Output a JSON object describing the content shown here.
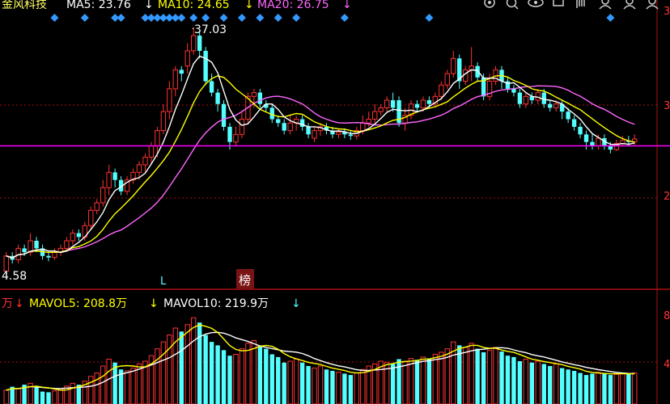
{
  "header": {
    "stock_name": "金风科技",
    "ma5": {
      "label": "MA5: 23.76",
      "arrow": "↓",
      "color": "#ffffff"
    },
    "ma10": {
      "label": "MA10: 24.65",
      "arrow": "↓",
      "color": "#ffff00"
    },
    "ma20": {
      "label": "MA20: 26.75",
      "arrow": "↓",
      "color": "#ff66ff"
    }
  },
  "volume_header": {
    "prefix": "万",
    "prefix_arrow": "↓",
    "mavol5": {
      "label": "MAVOL5: 208.8万",
      "arrow": "↓",
      "color": "#ffff00"
    },
    "mavol10": {
      "label": "MAVOL10: 219.9万",
      "arrow": "↓",
      "color": "#ffffff"
    }
  },
  "toolbar_icons": [
    "settings-icon",
    "search-icon",
    "eye-icon",
    "stamp-icon",
    "hand-icon",
    "user-icon",
    "user-icon"
  ],
  "annotations": {
    "high": "37.03",
    "low": "4.58",
    "badge": "榜",
    "marker": "L"
  },
  "right_axis_ticks": [
    "3",
    "3",
    "2",
    "8",
    "4"
  ],
  "colors": {
    "up": "#ff3333",
    "down": "#54ffff",
    "ma5": "#ffffff",
    "ma10": "#ffff00",
    "ma20": "#ff66ff",
    "hline": "#ff00ff",
    "divider": "#aa1111",
    "diamond": "#3399ff"
  },
  "chart_data": {
    "type": "candlestick",
    "price_range": [
      4.58,
      37.03
    ],
    "candles": [
      {
        "o": 5,
        "c": 7,
        "h": 7.5,
        "l": 4.58
      },
      {
        "o": 7,
        "c": 6.5,
        "h": 7.5,
        "l": 6
      },
      {
        "o": 6.5,
        "c": 8,
        "h": 8.5,
        "l": 6
      },
      {
        "o": 8,
        "c": 7.5,
        "h": 8.5,
        "l": 7
      },
      {
        "o": 7.5,
        "c": 9,
        "h": 10,
        "l": 7
      },
      {
        "o": 9,
        "c": 8,
        "h": 9.5,
        "l": 7.5
      },
      {
        "o": 8,
        "c": 7,
        "h": 8.5,
        "l": 6.5
      },
      {
        "o": 7,
        "c": 6.8,
        "h": 7.5,
        "l": 6.3
      },
      {
        "o": 6.8,
        "c": 7.5,
        "h": 8,
        "l": 6.5
      },
      {
        "o": 7.5,
        "c": 8,
        "h": 8.5,
        "l": 7
      },
      {
        "o": 8,
        "c": 9,
        "h": 9.5,
        "l": 7.5
      },
      {
        "o": 9,
        "c": 10,
        "h": 10.5,
        "l": 8.5
      },
      {
        "o": 10,
        "c": 9.5,
        "h": 10.5,
        "l": 9
      },
      {
        "o": 9.5,
        "c": 11,
        "h": 11.5,
        "l": 9
      },
      {
        "o": 11,
        "c": 13,
        "h": 13.5,
        "l": 10.5
      },
      {
        "o": 13,
        "c": 14,
        "h": 14.5,
        "l": 12.5
      },
      {
        "o": 14,
        "c": 16,
        "h": 17,
        "l": 13.5
      },
      {
        "o": 16,
        "c": 18,
        "h": 19,
        "l": 15
      },
      {
        "o": 18,
        "c": 17,
        "h": 18.5,
        "l": 16
      },
      {
        "o": 17,
        "c": 15.5,
        "h": 17.5,
        "l": 15
      },
      {
        "o": 15.5,
        "c": 17,
        "h": 17.5,
        "l": 15
      },
      {
        "o": 17,
        "c": 18,
        "h": 18.5,
        "l": 16.5
      },
      {
        "o": 18,
        "c": 19,
        "h": 19.5,
        "l": 17
      },
      {
        "o": 19,
        "c": 20,
        "h": 20.5,
        "l": 18
      },
      {
        "o": 20,
        "c": 21.5,
        "h": 22,
        "l": 19
      },
      {
        "o": 21.5,
        "c": 23.5,
        "h": 24,
        "l": 20
      },
      {
        "o": 23.5,
        "c": 26,
        "h": 27,
        "l": 23
      },
      {
        "o": 26,
        "c": 29,
        "h": 30,
        "l": 25
      },
      {
        "o": 29,
        "c": 31.5,
        "h": 32,
        "l": 28
      },
      {
        "o": 31.5,
        "c": 31,
        "h": 32,
        "l": 30
      },
      {
        "o": 32,
        "c": 34,
        "h": 35,
        "l": 31
      },
      {
        "o": 34,
        "c": 36,
        "h": 37.03,
        "l": 33.5
      },
      {
        "o": 36,
        "c": 34,
        "h": 36.5,
        "l": 33
      },
      {
        "o": 34,
        "c": 30,
        "h": 34.5,
        "l": 29.5
      },
      {
        "o": 30,
        "c": 28.5,
        "h": 31,
        "l": 28
      },
      {
        "o": 28.5,
        "c": 27,
        "h": 29,
        "l": 26
      },
      {
        "o": 27,
        "c": 24,
        "h": 27.5,
        "l": 23.5
      },
      {
        "o": 24,
        "c": 22,
        "h": 24.5,
        "l": 21
      },
      {
        "o": 22,
        "c": 23,
        "h": 24,
        "l": 21.5
      },
      {
        "o": 23,
        "c": 25,
        "h": 26,
        "l": 22.5
      },
      {
        "o": 25,
        "c": 28,
        "h": 28.5,
        "l": 24.5
      },
      {
        "o": 28,
        "c": 28.5,
        "h": 29,
        "l": 26.5
      },
      {
        "o": 28.5,
        "c": 27,
        "h": 29,
        "l": 26.5
      },
      {
        "o": 27,
        "c": 26.5,
        "h": 27.5,
        "l": 26
      },
      {
        "o": 26.5,
        "c": 25,
        "h": 27,
        "l": 24.5
      },
      {
        "o": 25,
        "c": 24.5,
        "h": 25.5,
        "l": 24
      },
      {
        "o": 24.5,
        "c": 23.5,
        "h": 25,
        "l": 23
      },
      {
        "o": 23.5,
        "c": 24.5,
        "h": 25.5,
        "l": 23
      },
      {
        "o": 24.5,
        "c": 25,
        "h": 25.5,
        "l": 23.5
      },
      {
        "o": 25,
        "c": 24,
        "h": 25.5,
        "l": 23.5
      },
      {
        "o": 24,
        "c": 23,
        "h": 24.5,
        "l": 22.5
      },
      {
        "o": 22.5,
        "c": 23.5,
        "h": 24,
        "l": 22
      },
      {
        "o": 23.5,
        "c": 24,
        "h": 24.5,
        "l": 22.8
      },
      {
        "o": 24,
        "c": 23.5,
        "h": 24.5,
        "l": 23
      },
      {
        "o": 23.5,
        "c": 23,
        "h": 24,
        "l": 22.5
      },
      {
        "o": 23,
        "c": 23.3,
        "h": 23.8,
        "l": 22.5
      },
      {
        "o": 23.3,
        "c": 23,
        "h": 23.8,
        "l": 22.5
      },
      {
        "o": 23,
        "c": 22.8,
        "h": 23.5,
        "l": 22.3
      },
      {
        "o": 22.8,
        "c": 23.5,
        "h": 24,
        "l": 22.3
      },
      {
        "o": 23.5,
        "c": 24.5,
        "h": 25.5,
        "l": 23
      },
      {
        "o": 24.5,
        "c": 25,
        "h": 26,
        "l": 24
      },
      {
        "o": 25,
        "c": 26,
        "h": 27,
        "l": 24.5
      },
      {
        "o": 26,
        "c": 26.5,
        "h": 27,
        "l": 25.5
      },
      {
        "o": 26.5,
        "c": 27.5,
        "h": 28,
        "l": 26
      },
      {
        "o": 27.5,
        "c": 26.5,
        "h": 28.5,
        "l": 26
      },
      {
        "o": 27.5,
        "c": 24.5,
        "h": 28,
        "l": 24
      },
      {
        "o": 24.5,
        "c": 25.5,
        "h": 26.5,
        "l": 23.5
      },
      {
        "o": 25.5,
        "c": 27,
        "h": 27.5,
        "l": 25
      },
      {
        "o": 27,
        "c": 26.5,
        "h": 27.5,
        "l": 26
      },
      {
        "o": 26.5,
        "c": 27.5,
        "h": 28,
        "l": 26
      },
      {
        "o": 27.5,
        "c": 27,
        "h": 28,
        "l": 26.5
      },
      {
        "o": 27,
        "c": 28,
        "h": 28.5,
        "l": 26.5
      },
      {
        "o": 28,
        "c": 29.5,
        "h": 30,
        "l": 27.5
      },
      {
        "o": 29.5,
        "c": 31,
        "h": 31.5,
        "l": 29
      },
      {
        "o": 31,
        "c": 33,
        "h": 34,
        "l": 30.5
      },
      {
        "o": 33,
        "c": 30,
        "h": 33.5,
        "l": 29
      },
      {
        "o": 30,
        "c": 31.5,
        "h": 32,
        "l": 29.5
      },
      {
        "o": 31.5,
        "c": 32,
        "h": 34.5,
        "l": 30
      },
      {
        "o": 32,
        "c": 30.5,
        "h": 32.5,
        "l": 30
      },
      {
        "o": 30.5,
        "c": 28,
        "h": 31,
        "l": 27.5
      },
      {
        "o": 28,
        "c": 30,
        "h": 31,
        "l": 27.5
      },
      {
        "o": 30,
        "c": 31.5,
        "h": 32,
        "l": 29.5
      },
      {
        "o": 31.5,
        "c": 30,
        "h": 32,
        "l": 29
      },
      {
        "o": 30,
        "c": 29,
        "h": 30.5,
        "l": 28.5
      },
      {
        "o": 29,
        "c": 28.5,
        "h": 29.5,
        "l": 28
      },
      {
        "o": 28.5,
        "c": 27,
        "h": 29,
        "l": 26.5
      },
      {
        "o": 27,
        "c": 28,
        "h": 28.5,
        "l": 26.5
      },
      {
        "o": 28,
        "c": 27.5,
        "h": 28.5,
        "l": 27
      },
      {
        "o": 27.5,
        "c": 28.5,
        "h": 29,
        "l": 27
      },
      {
        "o": 28.5,
        "c": 27,
        "h": 29,
        "l": 26.5
      },
      {
        "o": 27,
        "c": 26.5,
        "h": 27.5,
        "l": 26
      },
      {
        "o": 26.5,
        "c": 27,
        "h": 27.5,
        "l": 26
      },
      {
        "o": 27,
        "c": 26,
        "h": 27.5,
        "l": 25
      },
      {
        "o": 26,
        "c": 25,
        "h": 26.5,
        "l": 24.5
      },
      {
        "o": 25,
        "c": 24,
        "h": 25.5,
        "l": 23.5
      },
      {
        "o": 24,
        "c": 23,
        "h": 24.5,
        "l": 22.5
      },
      {
        "o": 23,
        "c": 22,
        "h": 23.5,
        "l": 21
      },
      {
        "o": 22,
        "c": 21.5,
        "h": 23,
        "l": 21
      },
      {
        "o": 21.5,
        "c": 22.5,
        "h": 23,
        "l": 21
      },
      {
        "o": 22.5,
        "c": 21.5,
        "h": 23,
        "l": 21
      },
      {
        "o": 21.5,
        "c": 21,
        "h": 22,
        "l": 20.5
      },
      {
        "o": 21,
        "c": 21.8,
        "h": 22.3,
        "l": 20.8
      },
      {
        "o": 21.8,
        "c": 22.2,
        "h": 22.8,
        "l": 21.5
      },
      {
        "o": 22.2,
        "c": 22,
        "h": 22.8,
        "l": 21.5
      },
      {
        "o": 22,
        "c": 22.4,
        "h": 23,
        "l": 21.6
      }
    ],
    "volumes": [
      20,
      25,
      22,
      28,
      30,
      24,
      18,
      17,
      19,
      22,
      26,
      30,
      28,
      33,
      40,
      45,
      55,
      65,
      60,
      50,
      48,
      52,
      58,
      62,
      70,
      80,
      90,
      100,
      110,
      105,
      115,
      125,
      118,
      100,
      90,
      85,
      78,
      70,
      72,
      80,
      88,
      92,
      85,
      80,
      72,
      68,
      60,
      62,
      65,
      60,
      55,
      52,
      55,
      50,
      48,
      46,
      44,
      42,
      45,
      50,
      55,
      58,
      62,
      60,
      58,
      65,
      62,
      66,
      64,
      68,
      66,
      72,
      75,
      80,
      90,
      85,
      82,
      88,
      80,
      75,
      78,
      82,
      76,
      70,
      68,
      62,
      65,
      60,
      62,
      58,
      55,
      58,
      52,
      50,
      48,
      45,
      42,
      44,
      46,
      44,
      42,
      43,
      45,
      44,
      45
    ],
    "hline_price": 21.5,
    "annotation_high": 37.03,
    "annotation_low": 4.58,
    "series": [
      {
        "name": "MA5"
      },
      {
        "name": "MA10"
      },
      {
        "name": "MA20"
      },
      {
        "name": "MAVOL5"
      },
      {
        "name": "MAVOL10"
      }
    ]
  }
}
